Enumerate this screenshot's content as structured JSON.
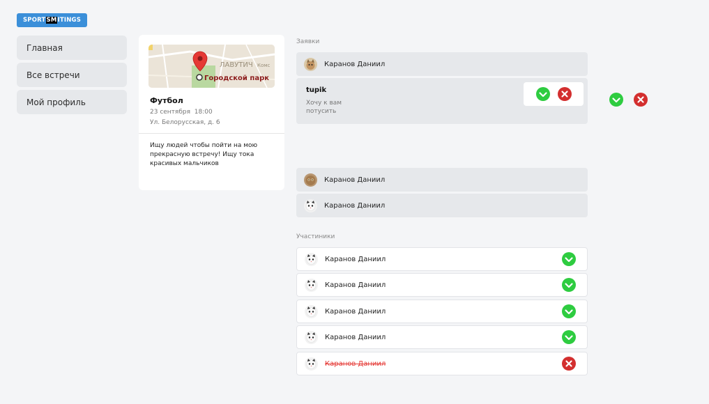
{
  "logo": {
    "part1": "SPORT",
    "part2": "SM",
    "part3": "ITINGS"
  },
  "nav": {
    "items": [
      {
        "label": "Главная"
      },
      {
        "label": "Все встречи"
      },
      {
        "label": "Мой профиль"
      }
    ]
  },
  "event": {
    "map_labels": {
      "district": "ЛАВУТИЧ",
      "park": "Городской парк",
      "side": "Комс"
    },
    "title": "Футбол",
    "date": "23 сентября",
    "time": "18:00",
    "address": "Ул. Белорусская, д. 6",
    "description": "Ищу людей чтобы пойти на мою прекрасную встречу! Ищу тока красивых мальчиков"
  },
  "requests": {
    "label": "Заявки",
    "top_item": {
      "name": "Каранов Даниил",
      "avatar": "cat-avatar"
    },
    "expanded": {
      "username": "tupik",
      "message": "Хочу к вам потусить"
    },
    "bottom_items": [
      {
        "name": "Каранов Даниил",
        "avatar": "cat-avatar"
      },
      {
        "name": "Каранов Даниил",
        "avatar": "cat-face-avatar"
      }
    ]
  },
  "participants": {
    "label": "Участиники",
    "items": [
      {
        "name": "Каранов Даниил",
        "status": "accepted"
      },
      {
        "name": "Каранов Даниил",
        "status": "accepted"
      },
      {
        "name": "Каранов Даниил",
        "status": "accepted"
      },
      {
        "name": "Каранов Даниил",
        "status": "accepted"
      },
      {
        "name": "Каранов Даниил",
        "status": "rejected"
      }
    ]
  },
  "colors": {
    "accept": "#2ecc40",
    "reject": "#d32f2f",
    "logo_bg": "#3b8fd9",
    "struck_name": "#e53935"
  }
}
